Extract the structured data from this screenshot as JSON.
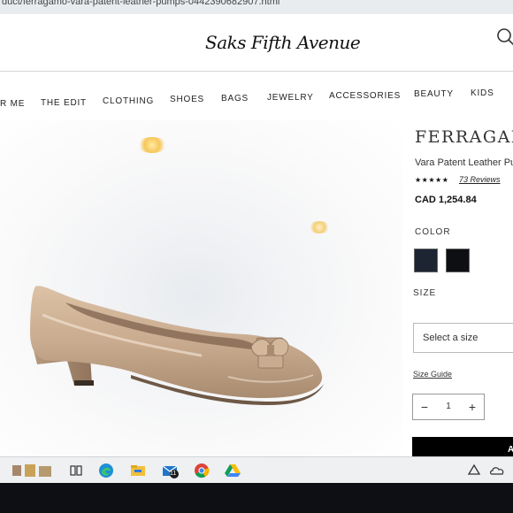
{
  "browser": {
    "url": "duct/ferragamo-vara-patent-leather-pumps-0442390682907.html"
  },
  "site": {
    "logo": "Saks Fifth Avenue"
  },
  "nav": {
    "items": [
      "R ME",
      "THE EDIT",
      "CLOTHING",
      "SHOES",
      "BAGS",
      "JEWELRY",
      "ACCESSORIES",
      "BEAUTY",
      "KIDS"
    ]
  },
  "product": {
    "brand": "FERRAGAMO",
    "name": "Vara Patent Leather Pu",
    "rating_stars": "★★★★★",
    "reviews": "73 Reviews",
    "price": "CAD 1,254.84",
    "color_label": "COLOR",
    "color_swatches": [
      "#1d2533",
      "#0e0f12"
    ],
    "size_label": "SIZE",
    "size_placeholder": "Select a size",
    "size_guide": "Size Guide",
    "quantity": "1",
    "qty_minus": "−",
    "qty_plus": "+",
    "add_button": "A",
    "shoe_color": "#c9ab8f"
  },
  "taskbar": {
    "icons": [
      "search-icon",
      "task-view-icon",
      "edge-browser-icon",
      "file-explorer-icon",
      "mail-icon",
      "chrome-icon",
      "google-drive-icon",
      "onedrive-icon"
    ],
    "mail_badge": "11"
  }
}
